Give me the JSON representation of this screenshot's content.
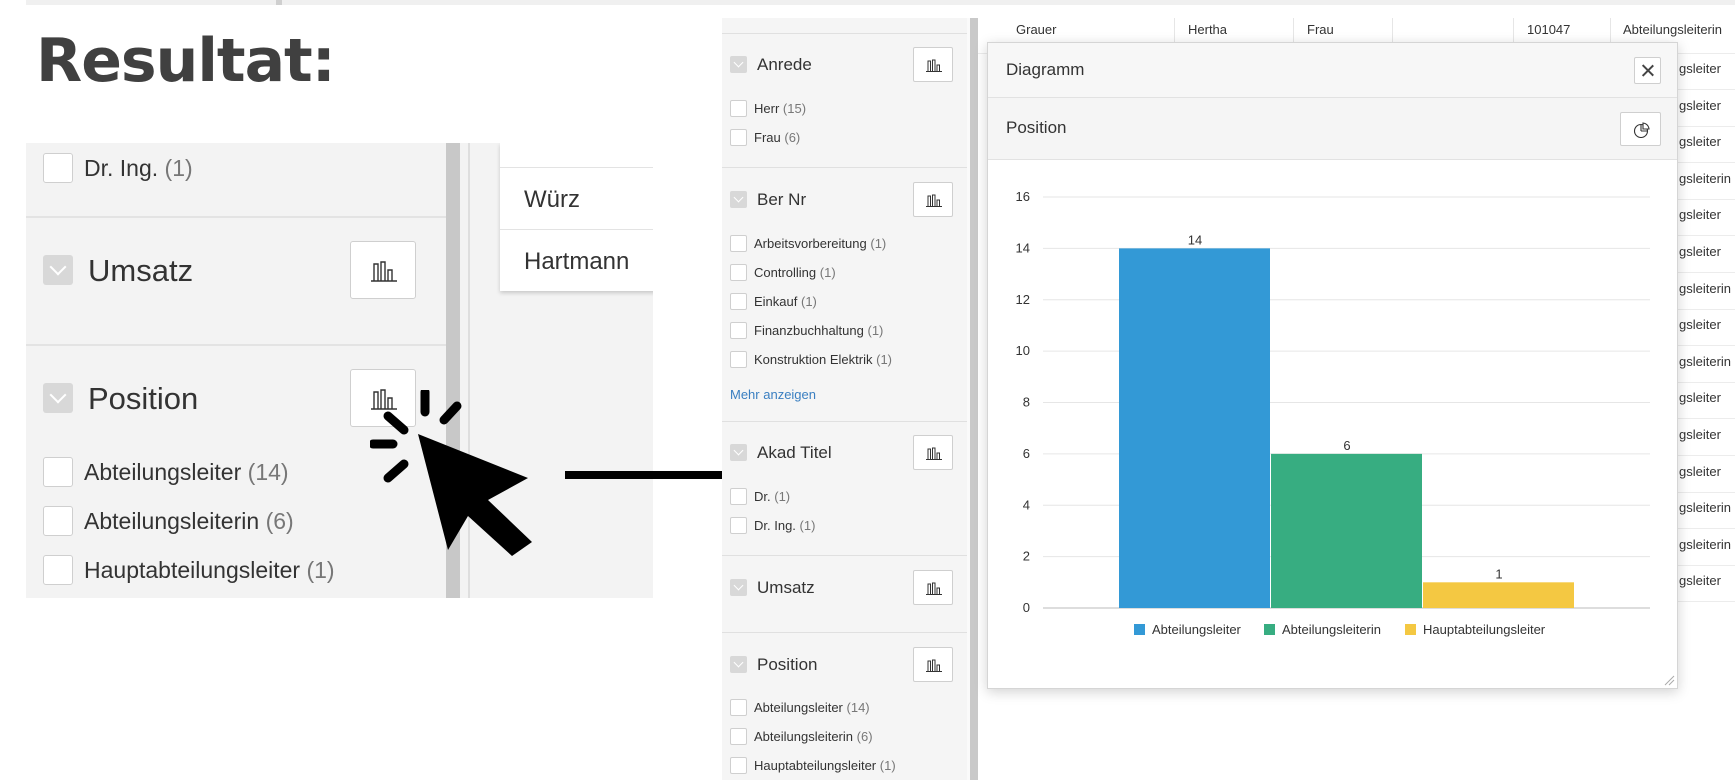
{
  "page_title": "Resultat:",
  "zoom": {
    "first_item": {
      "label": "Dr. Ing.",
      "count": "(1)"
    },
    "umsatz_label": "Umsatz",
    "position_label": "Position",
    "options": [
      {
        "label": "Abteilungsleiter",
        "count": "(14)"
      },
      {
        "label": "Abteilungsleiterin",
        "count": "(6)"
      },
      {
        "label": "Hauptabteilungsleiter",
        "count": "(1)"
      }
    ],
    "cards": [
      "Würz",
      "Hartmann"
    ]
  },
  "facets": {
    "anrede": {
      "label": "Anrede",
      "options": [
        {
          "label": "Herr",
          "count": "(15)"
        },
        {
          "label": "Frau",
          "count": "(6)"
        }
      ]
    },
    "ber_nr": {
      "label": "Ber Nr",
      "options": [
        {
          "label": "Arbeitsvorbereitung",
          "count": "(1)"
        },
        {
          "label": "Controlling",
          "count": "(1)"
        },
        {
          "label": "Einkauf",
          "count": "(1)"
        },
        {
          "label": "Finanzbuchhaltung",
          "count": "(1)"
        },
        {
          "label": "Konstruktion Elektrik",
          "count": "(1)"
        }
      ],
      "more": "Mehr anzeigen"
    },
    "akad_titel": {
      "label": "Akad Titel",
      "options": [
        {
          "label": "Dr.",
          "count": "(1)"
        },
        {
          "label": "Dr. Ing.",
          "count": "(1)"
        }
      ]
    },
    "umsatz": {
      "label": "Umsatz"
    },
    "position": {
      "label": "Position",
      "options": [
        {
          "label": "Abteilungsleiter",
          "count": "(14)"
        },
        {
          "label": "Abteilungsleiterin",
          "count": "(6)"
        },
        {
          "label": "Hauptabteilungsleiter",
          "count": "(1)"
        }
      ]
    }
  },
  "table": {
    "first_row": {
      "name": "Grauer",
      "first": "Hertha",
      "anrede": "Frau",
      "id": "101047",
      "position": "Abteilungsleiterin"
    },
    "right_col": [
      "gsleiter",
      "gsleiter",
      "gsleiter",
      "gsleiterin",
      "gsleiter",
      "gsleiter",
      "gsleiterin",
      "gsleiter",
      "gsleiterin",
      "gsleiter",
      "gsleiter",
      "gsleiter",
      "gsleiterin",
      "gsleiterin",
      "gsleiter"
    ]
  },
  "dialog": {
    "title": "Diagramm",
    "subtitle": "Position"
  },
  "chart_data": {
    "type": "bar",
    "categories": [
      "Abteilungsleiter",
      "Abteilungsleiterin",
      "Hauptabteilungsleiter"
    ],
    "values": [
      14,
      6,
      1
    ],
    "colors": [
      "#3399d6",
      "#37ad81",
      "#f4c842"
    ],
    "ylim": [
      0,
      16
    ],
    "yticks": [
      0,
      2,
      4,
      6,
      8,
      10,
      12,
      14,
      16
    ],
    "grid": true,
    "legend": "bottom"
  }
}
